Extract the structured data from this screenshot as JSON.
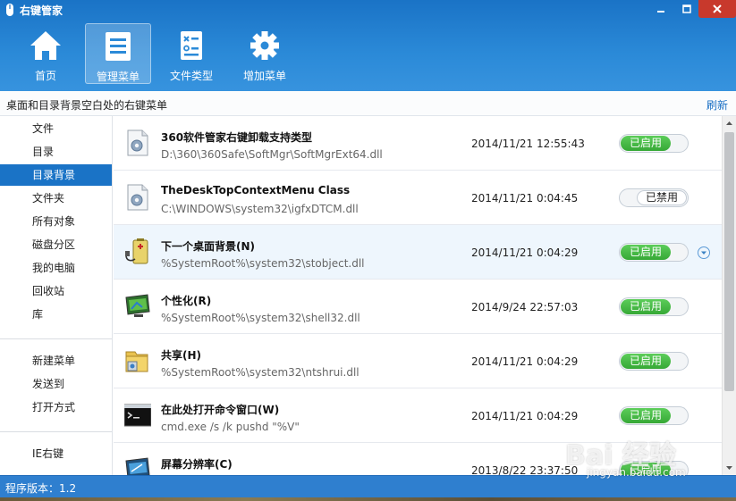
{
  "window": {
    "title": "右键管家",
    "buttons": [
      "minimize",
      "maximize",
      "close"
    ]
  },
  "nav": [
    {
      "label": "首页",
      "icon": "home-icon"
    },
    {
      "label": "管理菜单",
      "icon": "menu-list-icon",
      "active": true
    },
    {
      "label": "文件类型",
      "icon": "file-type-icon"
    },
    {
      "label": "增加菜单",
      "icon": "gear-icon"
    }
  ],
  "infobar": {
    "text": "桌面和目录背景空白处的右键菜单",
    "refresh": "刷新"
  },
  "sidebar": {
    "group1": [
      "文件",
      "目录",
      "目录背景",
      "文件夹",
      "所有对象",
      "磁盘分区",
      "我的电脑",
      "回收站",
      "库"
    ],
    "active": "目录背景",
    "group2": [
      "新建菜单",
      "发送到",
      "打开方式"
    ],
    "group3": [
      "IE右键"
    ]
  },
  "rows": [
    {
      "name": "360软件管家右键卸载支持类型",
      "path": "D:\\360\\360Safe\\SoftMgr\\SoftMgrExt64.dll",
      "date": "2014/11/21 12:55:43",
      "status": "已启用",
      "enabled": true,
      "icon": "dll-gear-icon"
    },
    {
      "name": "TheDeskTopContextMenu Class",
      "path": "C:\\WINDOWS\\system32\\igfxDTCM.dll",
      "date": "2014/11/21 0:04:45",
      "status": "已禁用",
      "enabled": false,
      "icon": "dll-gear-icon"
    },
    {
      "name": "下一个桌面背景(N)",
      "path": "%SystemRoot%\\system32\\stobject.dll",
      "date": "2014/11/21 0:04:29",
      "status": "已启用",
      "enabled": true,
      "icon": "battery-plug-icon",
      "highlight": true
    },
    {
      "name": "个性化(R)",
      "path": "%SystemRoot%\\system32\\shell32.dll",
      "date": "2014/9/24 22:57:03",
      "status": "已启用",
      "enabled": true,
      "icon": "monitor-icon"
    },
    {
      "name": "共享(H)",
      "path": "%SystemRoot%\\system32\\ntshrui.dll",
      "date": "2014/11/21 0:04:29",
      "status": "已启用",
      "enabled": true,
      "icon": "shared-folder-icon"
    },
    {
      "name": "在此处打开命令窗口(W)",
      "path": "cmd.exe /s /k pushd \"%V\"",
      "date": "2014/11/21 0:04:29",
      "status": "已启用",
      "enabled": true,
      "icon": "console-icon"
    },
    {
      "name": "屏幕分辨率(C)",
      "path": "",
      "date": "2013/8/22 23:37:50",
      "status": "已启用",
      "enabled": true,
      "icon": "screen-resolution-icon"
    }
  ],
  "statusbar": {
    "text": "程序版本：1.2"
  },
  "watermark": {
    "brand": "Bai 经验",
    "site": "jingyan.baidu.com"
  },
  "colors": {
    "accent": "#1a73c6",
    "enabled": "#3fb23f",
    "statusbar": "#2f7fcf"
  }
}
